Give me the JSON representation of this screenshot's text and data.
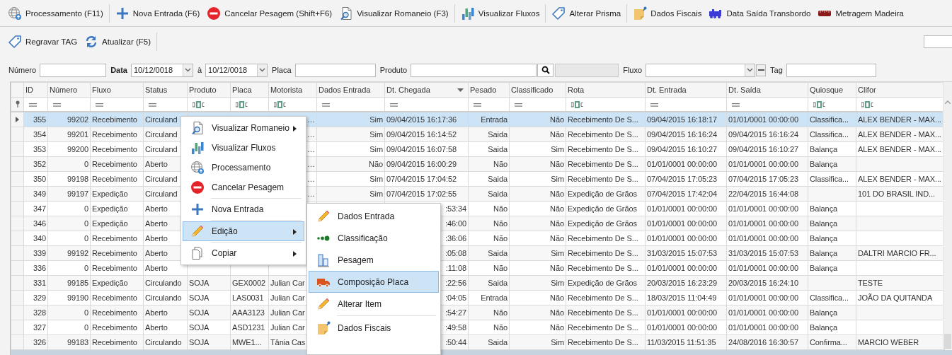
{
  "toolbar_rows": [
    [
      {
        "label": "Processamento (F11)"
      },
      {
        "kind": "separator"
      },
      {
        "label": "Nova Entrada (F6)"
      },
      {
        "label": "Cancelar Pesagem (Shift+F6)"
      },
      {
        "label": "Visualizar Romaneio (F3)"
      },
      {
        "kind": "separator"
      },
      {
        "label": "Visualizar Fluxos"
      },
      {
        "kind": "separator"
      },
      {
        "label": "Alterar Prisma"
      },
      {
        "kind": "separator"
      },
      {
        "label": "Dados Fiscais"
      },
      {
        "label": "Data Saída Transbordo"
      },
      {
        "label": "Metragem Madeira"
      }
    ],
    [
      {
        "label": "Regravar TAG"
      },
      {
        "label": "Atualizar (F5)"
      },
      {
        "kind": "separator"
      }
    ]
  ],
  "filters": [
    {
      "kind": "text",
      "label": "Número"
    },
    {
      "kind": "date",
      "label": "Data",
      "bold": true,
      "value": "10/12/0018"
    },
    {
      "kind": "date",
      "label": "à",
      "value": "10/12/0018"
    },
    {
      "kind": "text",
      "label": "Placa"
    },
    {
      "kind": "search",
      "label": "Produto"
    },
    {
      "kind": "combo",
      "label": "Fluxo"
    },
    {
      "kind": "text",
      "label": "Tag"
    }
  ],
  "table": {
    "columns": [
      {
        "label": "ID"
      },
      {
        "label": "Número"
      },
      {
        "label": "Fluxo"
      },
      {
        "label": "Status"
      },
      {
        "label": "Produto"
      },
      {
        "label": "Placa"
      },
      {
        "label": "Motorista"
      },
      {
        "label": "Dados Entrada"
      },
      {
        "label": "Dt. Chegada"
      },
      {
        "label": "Pesado"
      },
      {
        "label": "Classificado"
      },
      {
        "label": "Rota"
      },
      {
        "label": "Dt. Entrada"
      },
      {
        "label": "Dt. Saída"
      },
      {
        "label": "Quiosque"
      },
      {
        "label": "Clifor"
      }
    ],
    "rows": [
      {
        "selected": true,
        "cells": [
          "355",
          "99202",
          "Recebimento",
          "Circuland",
          null,
          null,
          {
            "text": "…",
            "cut_left": true
          },
          "Sim",
          "09/04/2015 16:17:36",
          "Entrada",
          "Não",
          "Recebimento De S...",
          "09/04/2015 16:18:17",
          "01/01/0001 00:00:00",
          "Classifica...",
          "ALEX BENDER - MAX..."
        ]
      },
      {
        "selected": false,
        "cells": [
          "354",
          "99201",
          "Recebimento",
          "Circuland",
          null,
          null,
          {
            "text": "…",
            "cut_left": true
          },
          "Sim",
          "09/04/2015 16:14:52",
          "Saida",
          "Não",
          "Recebimento De S...",
          "09/04/2015 16:16:24",
          "09/04/2015 16:16:24",
          "Classifica...",
          "ALEX BENDER - MAX..."
        ]
      },
      {
        "selected": false,
        "cells": [
          "353",
          "99200",
          "Recebimento",
          "Circuland",
          null,
          null,
          {
            "text": "…",
            "cut_left": true
          },
          "Sim",
          "09/04/2015 16:07:58",
          "Saida",
          "Sim",
          "Recebimento De S...",
          "09/04/2015 16:10:27",
          "09/04/2015 16:10:27",
          "Balança",
          "ALEX BENDER - MAX..."
        ]
      },
      {
        "selected": false,
        "cells": [
          "352",
          "0",
          "Recebimento",
          "Aberto",
          null,
          null,
          {
            "text": "…",
            "cut_left": true
          },
          "Não",
          "09/04/2015 16:00:29",
          "Não",
          "Não",
          "Recebimento De S...",
          "01/01/0001 00:00:00",
          "01/01/0001 00:00:00",
          "Balança",
          null
        ]
      },
      {
        "selected": false,
        "cells": [
          "350",
          "99198",
          "Recebimento",
          "Circuland",
          null,
          null,
          {
            "text": "…",
            "cut_left": true
          },
          "Sim",
          "07/04/2015 17:04:52",
          "Saida",
          "Sim",
          "Recebimento De S...",
          "07/04/2015 17:05:23",
          "07/04/2015 17:05:23",
          "Classifica...",
          "ALEX BENDER - MAX..."
        ]
      },
      {
        "selected": false,
        "cells": [
          "349",
          "99197",
          "Expedição",
          "Circuland",
          null,
          null,
          {
            "text": "…",
            "cut_left": true
          },
          "Sim",
          "07/04/2015 17:02:55",
          "Saida",
          "Não",
          "Expedição de Grãos",
          "07/04/2015 17:42:04",
          "22/04/2015 16:44:08",
          null,
          "101 DO BRASIL IND..."
        ]
      },
      {
        "selected": false,
        "cells": [
          "347",
          "0",
          "Expedição",
          "Aberto",
          null,
          null,
          null,
          null,
          {
            "text": ":53:34",
            "cut_left": true
          },
          "Não",
          "Não",
          "Expedição de Grãos",
          "01/01/0001 00:00:00",
          "01/01/0001 00:00:00",
          "Balança",
          null
        ]
      },
      {
        "selected": false,
        "cells": [
          "346",
          "0",
          "Expedição",
          "Aberto",
          null,
          null,
          null,
          null,
          {
            "text": ":46:00",
            "cut_left": true
          },
          "Não",
          "Não",
          "Expedição de Grãos",
          "01/01/0001 00:00:00",
          "01/01/0001 00:00:00",
          "Balança",
          null
        ]
      },
      {
        "selected": false,
        "cells": [
          "340",
          "0",
          "Recebimento",
          "Aberto",
          null,
          null,
          null,
          null,
          {
            "text": ":36:06",
            "cut_left": true
          },
          "Não",
          "Não",
          "Recebimento De S...",
          "01/01/0001 00:00:00",
          "01/01/0001 00:00:00",
          "Balança",
          null
        ]
      },
      {
        "selected": false,
        "cells": [
          "339",
          "99192",
          "Recebimento",
          "Aberto",
          null,
          null,
          null,
          null,
          {
            "text": ":05:08",
            "cut_left": true
          },
          "Saida",
          "Sim",
          "Recebimento De S...",
          "31/03/2015 15:07:53",
          "31/03/2015 15:07:53",
          "Balança",
          "DALTRI MARCIO FR..."
        ]
      },
      {
        "selected": false,
        "cells": [
          "336",
          "0",
          "Recebimento",
          "Aberto",
          null,
          null,
          null,
          null,
          {
            "text": ":11:08",
            "cut_left": true
          },
          "Não",
          "Não",
          "Recebimento De S...",
          "01/01/0001 00:00:00",
          "01/01/0001 00:00:00",
          "Balança",
          null
        ]
      },
      {
        "selected": false,
        "cells": [
          "331",
          "99185",
          "Expedição",
          "Circulando",
          "SOJA",
          "GEX0002",
          "Julian Car",
          null,
          {
            "text": ":22:56",
            "cut_left": true
          },
          "Saida",
          "Sim",
          "Expedição de Grãos",
          "20/03/2015 16:23:29",
          "20/03/2015 16:24:10",
          null,
          "TESTE"
        ]
      },
      {
        "selected": false,
        "cells": [
          "329",
          "99190",
          "Recebimento",
          "Circulando",
          "SOJA",
          "LAS0031",
          "Julian Car",
          null,
          {
            "text": ":04:05",
            "cut_left": true
          },
          "Entrada",
          "Não",
          "Recebimento De S...",
          "18/03/2015 11:04:49",
          "01/01/0001 00:00:00",
          "Classifica...",
          "JOÃO DA QUITANDA"
        ]
      },
      {
        "selected": false,
        "cells": [
          "328",
          "0",
          "Recebimento",
          "Aberto",
          "SOJA",
          "AAA3123",
          "Julian Car",
          null,
          {
            "text": ":54:27",
            "cut_left": true
          },
          "Não",
          "Não",
          "Recebimento De S...",
          "01/01/0001 00:00:00",
          "01/01/0001 00:00:00",
          "Balança",
          null
        ]
      },
      {
        "selected": false,
        "cells": [
          "327",
          "0",
          "Recebimento",
          "Aberto",
          "SOJA",
          "ASD1231",
          "Julian Car",
          null,
          {
            "text": ":49:58",
            "cut_left": true
          },
          "Não",
          "Não",
          "Recebimento De S...",
          "01/01/0001 00:00:00",
          "01/01/0001 00:00:00",
          "Balança",
          null
        ]
      },
      {
        "selected": false,
        "cells": [
          "326",
          "99183",
          "Recebimento",
          "Circulando",
          "SOJA",
          "MWE1...",
          "Tânia Cas",
          null,
          {
            "text": ":50:44",
            "cut_left": true
          },
          "Saida",
          "Sim",
          "Recebimento De S...",
          "11/03/2015 11:51:35",
          "24/08/2016 16:30:57",
          "Confirma...",
          "MARCIO WEBER"
        ]
      }
    ]
  },
  "context_menu": {
    "items": [
      {
        "label": "Visualizar Romaneio",
        "submenu": true,
        "selected": false
      },
      {
        "label": "Visualizar Fluxos",
        "submenu": false,
        "selected": false
      },
      {
        "label": "Processamento",
        "submenu": false,
        "selected": false
      },
      {
        "label": "Cancelar Pesagem",
        "submenu": false,
        "selected": false
      },
      {
        "label": "Nova Entrada",
        "submenu": false,
        "selected": false,
        "separator_before": true
      },
      {
        "label": "Edição",
        "submenu": true,
        "selected": true,
        "separator_before": true
      },
      {
        "label": "Copiar",
        "submenu": true,
        "selected": false,
        "separator_before": true
      }
    ]
  },
  "submenu": {
    "items": [
      {
        "label": "Dados Entrada",
        "selected": false
      },
      {
        "label": "Classificação",
        "selected": false
      },
      {
        "label": "Pesagem",
        "selected": false
      },
      {
        "label": "Composição Placa",
        "selected": true
      },
      {
        "label": "Alterar Item",
        "selected": false
      },
      {
        "label": "Dados Fiscais",
        "selected": false,
        "separator_before": true
      }
    ]
  }
}
